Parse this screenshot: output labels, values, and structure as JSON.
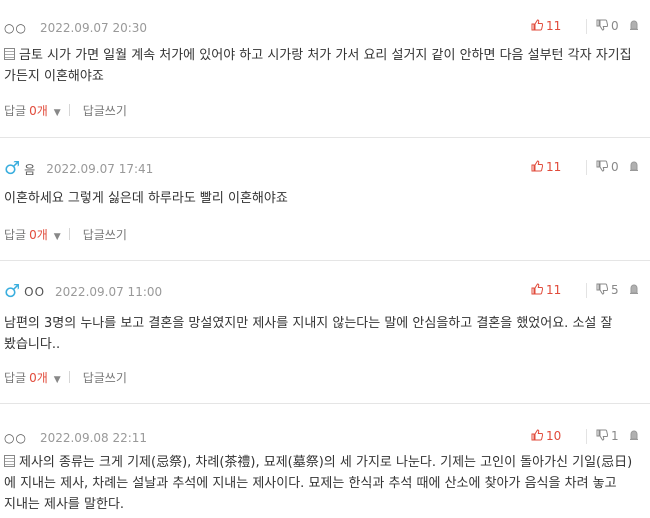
{
  "comments": [
    {
      "nick": "○○",
      "gender": "",
      "date": "2022.09.07 20:30",
      "up": "11",
      "down": "0",
      "has_memo_icon": true,
      "body": "금토 시가 가면 일월 계속 처가에 있어야 하고 시가랑 처가 가서 요리 설거지 같이 안하면 다음 설부턴 각자 자기집 가든지 이혼해야죠",
      "reply_label": "답글",
      "reply_count": "0개",
      "write_label": "답글쓰기"
    },
    {
      "nick": "음",
      "gender": "♂",
      "date": "2022.09.07 17:41",
      "up": "11",
      "down": "0",
      "has_memo_icon": false,
      "body": "이혼하세요 그렇게 싫은데 하루라도 빨리 이혼해야죠",
      "reply_label": "답글",
      "reply_count": "0개",
      "write_label": "답글쓰기"
    },
    {
      "nick": "OO",
      "gender": "♂",
      "date": "2022.09.07 11:00",
      "up": "11",
      "down": "5",
      "has_memo_icon": false,
      "body": "남편의 3명의 누나를 보고 결혼을 망설였지만 제사를 지내지 않는다는 말에 안심을하고 결혼을 했었어요. 소설 잘 봤습니다..",
      "reply_label": "답글",
      "reply_count": "0개",
      "write_label": "답글쓰기"
    },
    {
      "nick": "○○",
      "gender": "",
      "date": "2022.09.08 22:11",
      "up": "10",
      "down": "1",
      "has_memo_icon": true,
      "body": "제사의 종류는 크게 기제(忌祭), 차례(茶禮), 묘제(墓祭)의 세 가지로 나눈다. 기제는 고인이 돌아가신 기일(忌日)에 지내는 제사, 차례는 설날과 추석에 지내는 제사이다. 묘제는 한식과 추석 때에 산소에 찾아가 음식을 차려 놓고 지내는 제사를 말한다."
    }
  ],
  "icons": {
    "upvote": "thumbs-up-icon",
    "downvote": "thumbs-down-icon",
    "report": "report-icon",
    "memo": "memo-icon",
    "gender": "male-icon",
    "dropdown": "caret-down-icon"
  },
  "colors": {
    "upvote": "#e14b3b",
    "downvote": "#888888",
    "gender": "#3aaede",
    "reply_count": "#e14b3b",
    "date": "#999999"
  }
}
